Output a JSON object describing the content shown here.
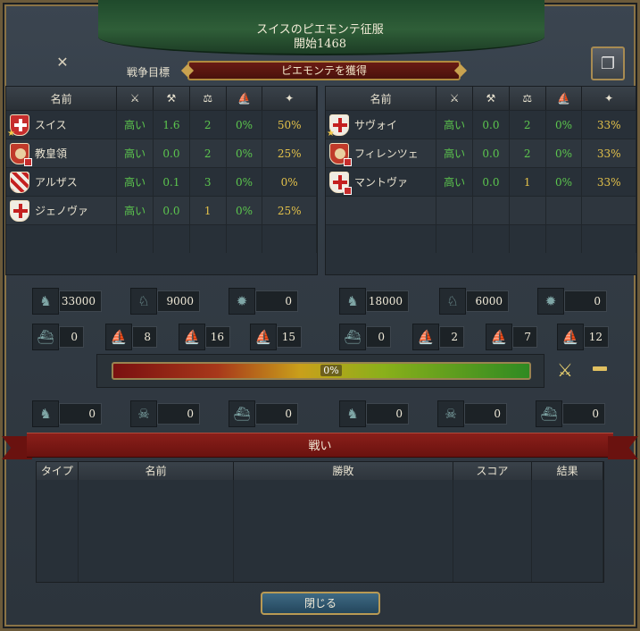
{
  "window": {
    "title": "スイスのピエモンテ征服",
    "subtitle": "開始1468",
    "war_goal_label": "戦争目標",
    "war_goal": "ピエモンテを獲得"
  },
  "table_headers": {
    "name": "名前"
  },
  "attackers": [
    {
      "name": "スイス",
      "flag": "red-cross",
      "leader": true,
      "c1": "高い",
      "c2": "1.6",
      "c3": "2",
      "c4": "0%",
      "c5": "50%"
    },
    {
      "name": "教皇領",
      "flag": "papal",
      "leader": false,
      "c1": "高い",
      "c2": "0.0",
      "c3": "2",
      "c4": "0%",
      "c5": "25%"
    },
    {
      "name": "アルザス",
      "flag": "stripe",
      "leader": false,
      "c1": "高い",
      "c2": "0.1",
      "c3": "3",
      "c4": "0%",
      "c5": "0%"
    },
    {
      "name": "ジェノヴァ",
      "flag": "white-cross",
      "leader": false,
      "c1": "高い",
      "c2": "0.0",
      "c3": "1",
      "c4": "0%",
      "c5": "25%"
    }
  ],
  "defenders": [
    {
      "name": "サヴォイ",
      "flag": "white-cross",
      "leader": true,
      "c1": "高い",
      "c2": "0.0",
      "c3": "2",
      "c4": "0%",
      "c5": "33%"
    },
    {
      "name": "フィレンツェ",
      "flag": "papal",
      "leader": false,
      "c1": "高い",
      "c2": "0.0",
      "c3": "2",
      "c4": "0%",
      "c5": "33%"
    },
    {
      "name": "マントヴァ",
      "flag": "white-cross",
      "leader": false,
      "c1": "高い",
      "c2": "0.0",
      "c3": "1",
      "c4": "0%",
      "c5": "33%"
    }
  ],
  "attacker_forces": {
    "infantry": "33000",
    "cavalry": "9000",
    "artillery": "0",
    "heavy_ships": "0",
    "light_ships": "8",
    "galleys": "16",
    "transports": "15",
    "inf_losses": "0",
    "attrition_losses": "0",
    "ship_losses": "0"
  },
  "defender_forces": {
    "infantry": "18000",
    "cavalry": "6000",
    "artillery": "0",
    "heavy_ships": "0",
    "light_ships": "2",
    "galleys": "7",
    "transports": "12",
    "inf_losses": "0",
    "attrition_losses": "0",
    "ship_losses": "0"
  },
  "war_score": {
    "label": "0%",
    "value": 0
  },
  "battles": {
    "title": "戦い",
    "headers": {
      "type": "タイプ",
      "name": "名前",
      "result": "勝敗",
      "score": "スコア",
      "outcome": "結果"
    }
  },
  "close_label": "閉じる",
  "colors": {
    "green": "#5cc64e",
    "yellow": "#e3c14a",
    "banner": "#2f5e38",
    "ribbon": "#8a1f1a"
  }
}
